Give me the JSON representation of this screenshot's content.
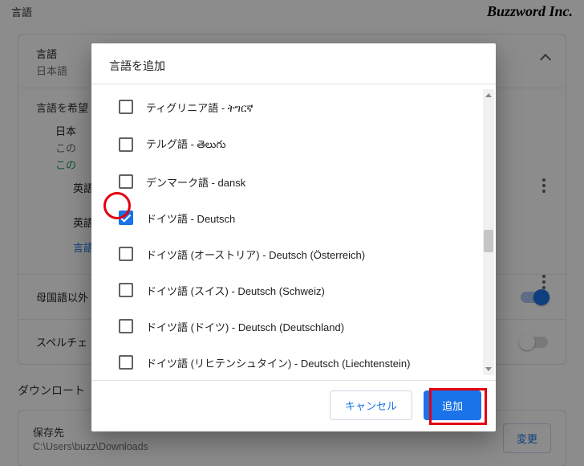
{
  "topbar": {
    "title": "言語",
    "brand": "Buzzword Inc."
  },
  "card": {
    "lang_header": {
      "title": "言語",
      "subtitle": "日本語"
    },
    "pref_line": "言語を希望",
    "ja": {
      "name": "日本",
      "note": "この",
      "link": "この"
    },
    "en_line1": "英語",
    "en_line2": "英語",
    "add_link": "言語",
    "offer_translate": "母国語以外",
    "spellcheck": "スペルチェ"
  },
  "downloads": {
    "heading": "ダウンロート",
    "save_to_label": "保存先",
    "path": "C:\\Users\\buzz\\Downloads",
    "change": "変更"
  },
  "dialog": {
    "title": "言語を追加",
    "items": [
      {
        "label": "ティグリニア語 - ትግርኛ",
        "checked": false
      },
      {
        "label": "テルグ語 - తెలుగు",
        "checked": false
      },
      {
        "label": "デンマーク語 - dansk",
        "checked": false
      },
      {
        "label": "ドイツ語 - Deutsch",
        "checked": true
      },
      {
        "label": "ドイツ語 (オーストリア) - Deutsch (Österreich)",
        "checked": false
      },
      {
        "label": "ドイツ語 (スイス) - Deutsch (Schweiz)",
        "checked": false
      },
      {
        "label": "ドイツ語 (ドイツ) - Deutsch (Deutschland)",
        "checked": false
      },
      {
        "label": "ドイツ語 (リヒテンシュタイン) - Deutsch (Liechtenstein)",
        "checked": false
      }
    ],
    "cancel": "キャンセル",
    "add": "追加"
  }
}
